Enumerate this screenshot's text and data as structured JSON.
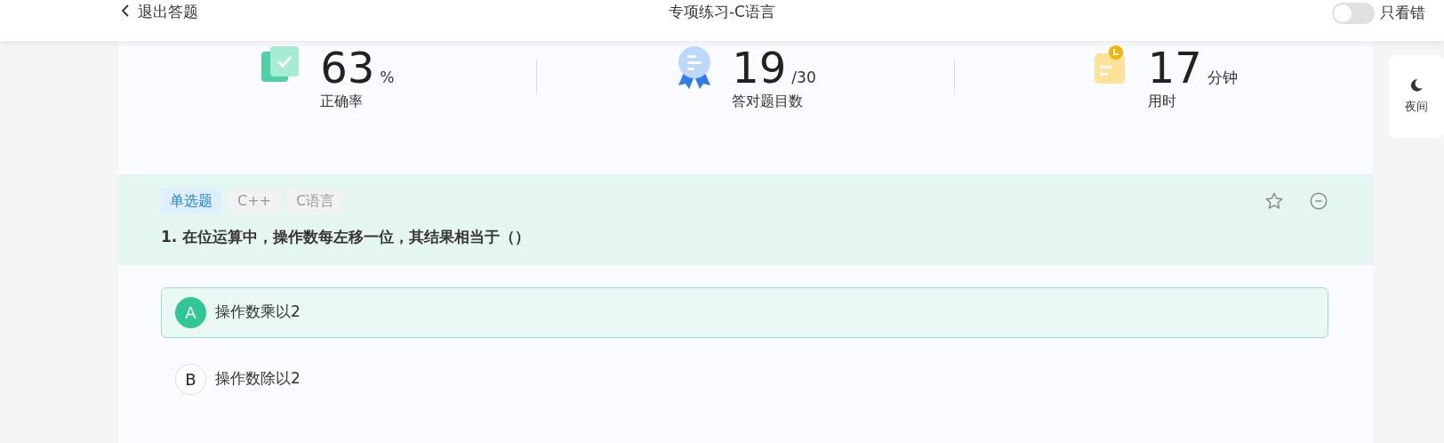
{
  "header": {
    "back": "退出答题",
    "title": "专项练习-C语言",
    "toggle": {
      "label": "只看错",
      "on": false
    }
  },
  "stats": [
    {
      "kind": "accuracy",
      "value": "63",
      "unit": "%",
      "label": "正确率"
    },
    {
      "kind": "correct",
      "value": "19",
      "unit": "/30",
      "label": "答对题目数"
    },
    {
      "kind": "time",
      "value": "17",
      "unit": "分钟",
      "label": "用时"
    }
  ],
  "night_button": {
    "label": "夜间"
  },
  "question": {
    "tags": [
      {
        "text": "单选题",
        "kind": "type"
      },
      {
        "text": "C++",
        "kind": "topic"
      },
      {
        "text": "C语言",
        "kind": "topic"
      }
    ],
    "text": "1. 在位运算中，操作数每左移一位，其结果相当于（）",
    "starred": false,
    "options": [
      {
        "letter": "A",
        "text": "操作数乘以2",
        "selected": true
      },
      {
        "letter": "B",
        "text": "操作数除以2",
        "selected": false
      }
    ]
  }
}
